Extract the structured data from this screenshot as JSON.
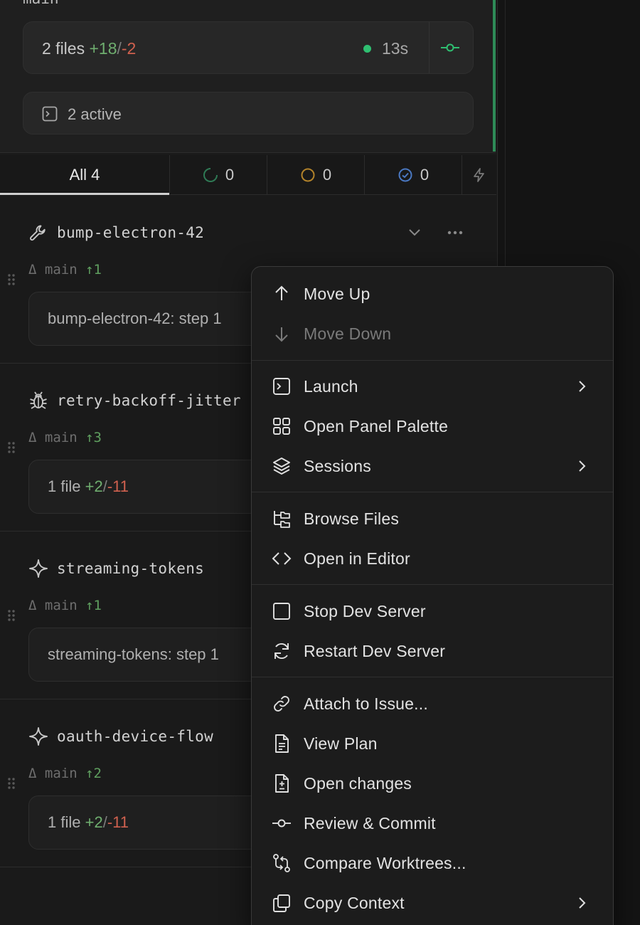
{
  "sidebar": {
    "top_branch": "main",
    "changes": {
      "files": "2 files",
      "added": "+18",
      "sep": "/",
      "removed": "-2",
      "elapsed": "13s"
    },
    "active": {
      "label": "2 active"
    },
    "tabs": [
      {
        "label": "All 4"
      },
      {
        "count": "0"
      },
      {
        "count": "0"
      },
      {
        "count": "0"
      }
    ]
  },
  "worktrees": [
    {
      "name": "bump-electron-42",
      "branch": "Δ main",
      "ahead": "↑1",
      "box_text": "bump-electron-42: step 1",
      "icon": "wrench-icon"
    },
    {
      "name": "retry-backoff-jitter",
      "branch": "Δ main",
      "ahead": "↑3",
      "files": "1 file",
      "added": "+2",
      "sep": "/",
      "removed": "-11",
      "icon": "bug-icon"
    },
    {
      "name": "streaming-tokens",
      "branch": "Δ main",
      "ahead": "↑1",
      "box_text": "streaming-tokens: step 1",
      "icon": "sparkle-icon"
    },
    {
      "name": "oauth-device-flow",
      "branch": "Δ main",
      "ahead": "↑2",
      "files": "1 file",
      "added": "+2",
      "sep": "/",
      "removed": "-11",
      "icon": "sparkle-icon"
    }
  ],
  "menu": {
    "move_up": "Move Up",
    "move_down": "Move Down",
    "launch": "Launch",
    "open_panel_palette": "Open Panel Palette",
    "sessions": "Sessions",
    "browse_files": "Browse Files",
    "open_in_editor": "Open in Editor",
    "stop_dev_server": "Stop Dev Server",
    "restart_dev_server": "Restart Dev Server",
    "attach_to_issue": "Attach to Issue...",
    "view_plan": "View Plan",
    "open_changes": "Open changes",
    "review_commit": "Review & Commit",
    "compare_worktrees": "Compare Worktrees...",
    "copy_context": "Copy Context"
  },
  "colors": {
    "added": "#6fae6f",
    "removed": "#d0614f",
    "status_dot": "#2fbf71",
    "accent_bar": "#2e8b57"
  }
}
